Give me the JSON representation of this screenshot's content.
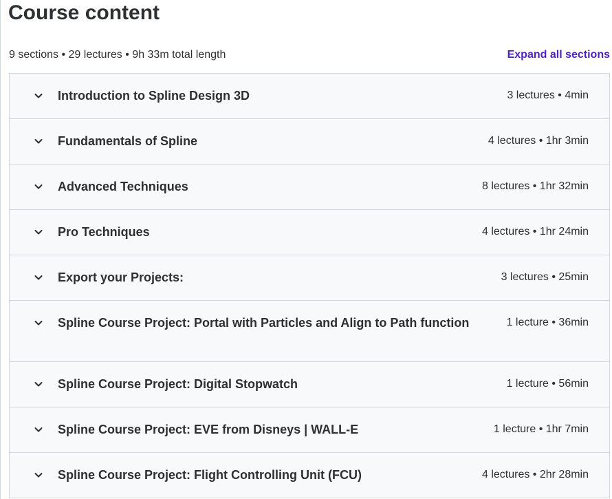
{
  "header": {
    "title": "Course content",
    "summary": "9 sections • 29 lectures • 9h 33m total length",
    "expand_label": "Expand all sections"
  },
  "colors": {
    "accent": "#5022c3",
    "row_bg": "#f7f9fa",
    "border": "#d1d7dc",
    "text": "#2d2f31"
  },
  "icons": {
    "section_toggle": "chevron-down-icon"
  },
  "sections": [
    {
      "title": "Introduction to Spline Design 3D",
      "meta": "3 lectures • 4min"
    },
    {
      "title": "Fundamentals of Spline",
      "meta": "4 lectures • 1hr 3min"
    },
    {
      "title": "Advanced Techniques",
      "meta": "8 lectures • 1hr 32min"
    },
    {
      "title": "Pro Techniques",
      "meta": "4 lectures • 1hr 24min"
    },
    {
      "title": "Export your Projects:",
      "meta": "3 lectures • 25min"
    },
    {
      "title": "Spline Course Project: Portal with Particles and Align to Path function",
      "meta": "1 lecture • 36min"
    },
    {
      "title": "Spline Course Project: Digital Stopwatch",
      "meta": "1 lecture • 56min"
    },
    {
      "title": "Spline Course Project: EVE from Disneys | WALL-E",
      "meta": "1 lecture • 1hr 7min"
    },
    {
      "title": "Spline Course Project: Flight Controlling Unit (FCU)",
      "meta": "4 lectures • 2hr 28min"
    }
  ]
}
